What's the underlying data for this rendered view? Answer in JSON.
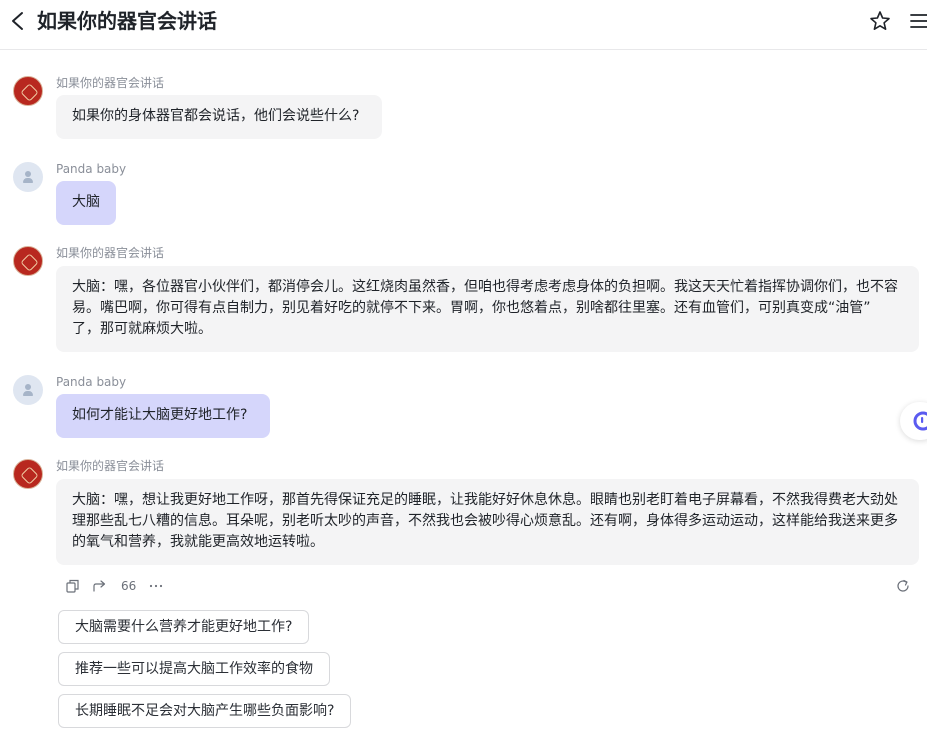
{
  "header": {
    "title": "如果你的器官会讲话",
    "back_icon": "chevron-left-icon",
    "star_icon": "star-icon",
    "menu_icon": "hamburger-menu-icon"
  },
  "messages": [
    {
      "role": "bot",
      "sender": "如果你的器官会讲话",
      "text": "如果你的身体器官都会说话，他们会说些什么?"
    },
    {
      "role": "user",
      "sender": "Panda baby",
      "text": "大脑"
    },
    {
      "role": "bot",
      "sender": "如果你的器官会讲话",
      "lines": [
        "大脑：嘿，各位器官小伙伴们，都消停会儿。这红烧肉虽然香，但咱也得考虑考虑身体的负担啊。我这天天忙着指挥协调你们，也不容",
        "易。嘴巴啊，你可得有点自制力，别见着好吃的就停不下来。胃啊，你也悠着点，别啥都往里塞。还有血管们，可别真变成“油管”",
        "了，那可就麻烦大啦。"
      ]
    },
    {
      "role": "user",
      "sender": "Panda baby",
      "text": "如何才能让大脑更好地工作?"
    },
    {
      "role": "bot",
      "sender": "如果你的器官会讲话",
      "lines": [
        "大脑：嘿，想让我更好地工作呀，那首先得保证充足的睡眠，让我能好好休息休息。眼睛也别老盯着电子屏幕看，不然我得费老大劲处",
        "理那些乱七八糟的信息。耳朵呢，别老听太吵的声音，不然我也会被吵得心烦意乱。还有啊，身体得多运动运动，这样能给我送来更多",
        "的氧气和营养，我就能更高效地运转啦。"
      ]
    }
  ],
  "actions": {
    "copy_icon": "copy-icon",
    "share_icon": "share-icon",
    "count": "66",
    "more_icon": "more-icon",
    "regenerate_icon": "refresh-icon"
  },
  "suggestions": [
    "大脑需要什么营养才能更好地工作?",
    "推荐一些可以提高大脑工作效率的食物",
    "长期睡眠不足会对大脑产生哪些负面影响?"
  ],
  "colors": {
    "user_bubble": "#d5d6fb",
    "bot_bubble": "#f4f4f5",
    "accent": "#5b5bf0",
    "bot_avatar": "#b8281f"
  }
}
